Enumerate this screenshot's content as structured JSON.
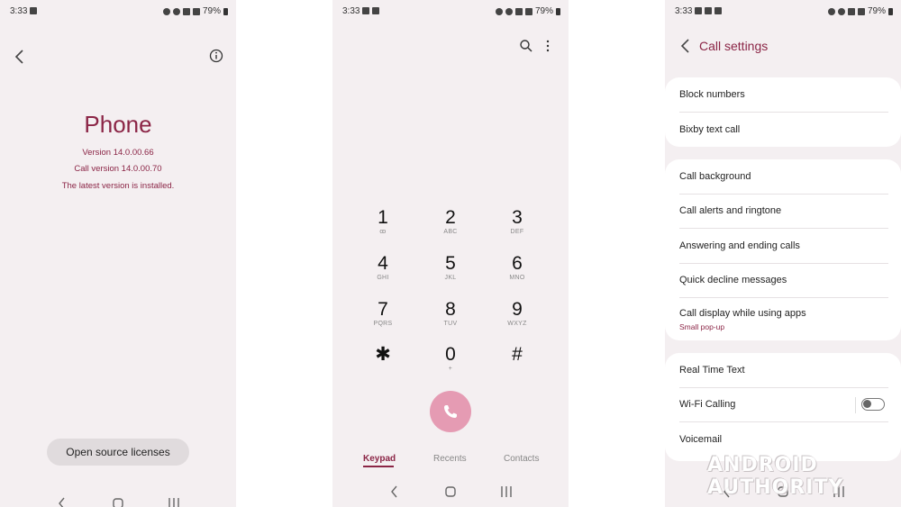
{
  "screen1": {
    "status": {
      "time": "3:33",
      "battery": "79%"
    },
    "title": "Phone",
    "version": "Version 14.0.00.66",
    "call_version": "Call version 14.0.00.70",
    "latest": "The latest version is installed.",
    "oss_button": "Open source licenses"
  },
  "screen2": {
    "status": {
      "time": "3:33",
      "battery": "79%"
    },
    "keys": [
      {
        "digit": "1",
        "letters": "ꝏ"
      },
      {
        "digit": "2",
        "letters": "ABC"
      },
      {
        "digit": "3",
        "letters": "DEF"
      },
      {
        "digit": "4",
        "letters": "GHI"
      },
      {
        "digit": "5",
        "letters": "JKL"
      },
      {
        "digit": "6",
        "letters": "MNO"
      },
      {
        "digit": "7",
        "letters": "PQRS"
      },
      {
        "digit": "8",
        "letters": "TUV"
      },
      {
        "digit": "9",
        "letters": "WXYZ"
      },
      {
        "digit": "✱",
        "letters": ""
      },
      {
        "digit": "0",
        "letters": "+"
      },
      {
        "digit": "#",
        "letters": ""
      }
    ],
    "tabs": {
      "keypad": "Keypad",
      "recents": "Recents",
      "contacts": "Contacts"
    }
  },
  "screen3": {
    "status": {
      "time": "3:33",
      "battery": "79%"
    },
    "title": "Call settings",
    "group1": [
      "Block numbers",
      "Bixby text call"
    ],
    "group2": [
      "Call background",
      "Call alerts and ringtone",
      "Answering and ending calls",
      "Quick decline messages",
      "Call display while using apps"
    ],
    "call_display_sub": "Small pop-up",
    "group3": [
      "Real Time Text",
      "Wi-Fi Calling",
      "Voicemail"
    ],
    "wifi_calling_on": false
  },
  "watermark": "ANDROID AUTHORITY",
  "colors": {
    "accent": "#8b2546",
    "call_button": "#e59bb3",
    "screen_bg": "#f4eff1"
  }
}
